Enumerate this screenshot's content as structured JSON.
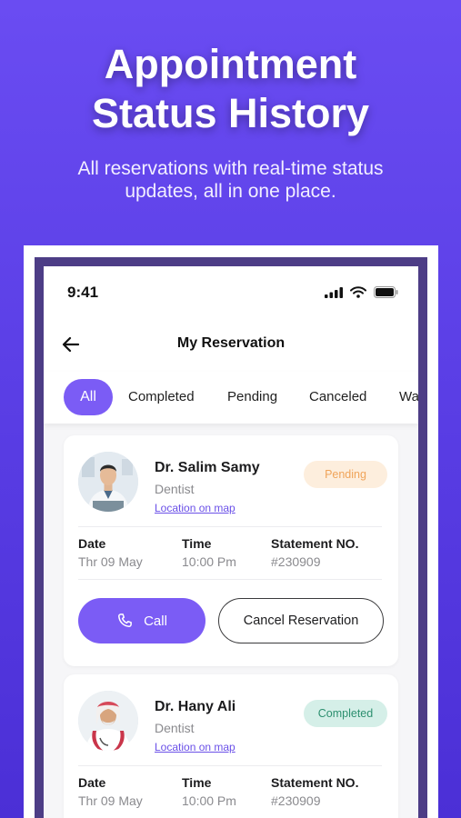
{
  "hero": {
    "title_line1": "Appointment",
    "title_line2": "Status History",
    "subtitle_line1": "All reservations with real-time status",
    "subtitle_line2": "updates, all in one place."
  },
  "status_bar": {
    "time": "9:41"
  },
  "header": {
    "title": "My Reservation"
  },
  "tabs": [
    {
      "label": "All",
      "active": true
    },
    {
      "label": "Completed"
    },
    {
      "label": "Pending"
    },
    {
      "label": "Canceled"
    },
    {
      "label": "Wa"
    }
  ],
  "reservations": [
    {
      "doctor": "Dr. Salim Samy",
      "specialty": "Dentist",
      "location_link": "Location on map",
      "status": "Pending",
      "date_label": "Date",
      "date": "Thr 09 May",
      "time_label": "Time",
      "time": "10:00 Pm",
      "statement_label": "Statement NO.",
      "statement": "#230909",
      "call_label": "Call",
      "cancel_label": "Cancel Reservation"
    },
    {
      "doctor": "Dr. Hany Ali",
      "specialty": "Dentist",
      "location_link": "Location on map",
      "status": "Completed",
      "date_label": "Date",
      "date": "Thr 09 May",
      "time_label": "Time",
      "time": "10:00 Pm",
      "statement_label": "Statement NO.",
      "statement": "#230909"
    }
  ],
  "colors": {
    "brand": "#7b5cf5",
    "pending_bg": "#fdeedd",
    "pending_text": "#f0a45a",
    "completed_bg": "#d5efe8",
    "completed_text": "#2c8f6f"
  },
  "icons": [
    "back-arrow-icon",
    "signal-icon",
    "wifi-icon",
    "battery-icon",
    "phone-icon"
  ]
}
